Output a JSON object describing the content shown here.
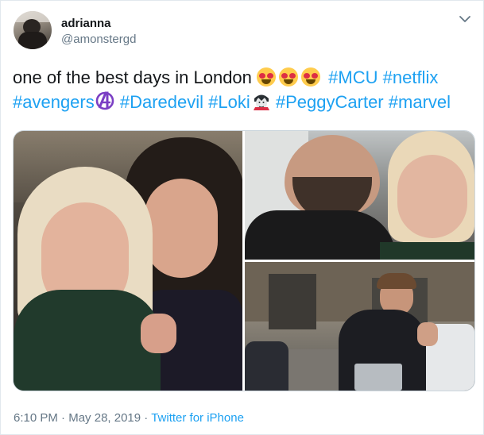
{
  "user": {
    "name": "adrianna",
    "handle": "@amonstergd",
    "avatar_icon": "profile-photo"
  },
  "tweet": {
    "text_start": "one of the best days in London",
    "hashtags": {
      "mcu": "#MCU",
      "netflix": "#netflix",
      "avengers": "#avengers",
      "daredevil": "#Daredevil",
      "loki": "#Loki",
      "peggycarter": "#PeggyCarter",
      "marvel": "#marvel"
    },
    "emojis": [
      "heart-eyes-emoji",
      "heart-eyes-emoji",
      "heart-eyes-emoji",
      "avengers-logo-emoji",
      "vampire-emoji"
    ]
  },
  "media": {
    "photos": [
      "photo-selfie-with-woman",
      "photo-selfie-with-bearded-man",
      "photo-man-on-street-with-laptop"
    ]
  },
  "meta": {
    "time": "6:10 PM",
    "separator1": " · ",
    "date": "May 28, 2019",
    "separator2": " · ",
    "source": "Twitter for iPhone"
  },
  "colors": {
    "link": "#1da1f2",
    "secondary": "#657786",
    "text": "#14171a",
    "border": "#e1e8ed"
  },
  "icons": {
    "menu": "chevron-down-icon"
  }
}
